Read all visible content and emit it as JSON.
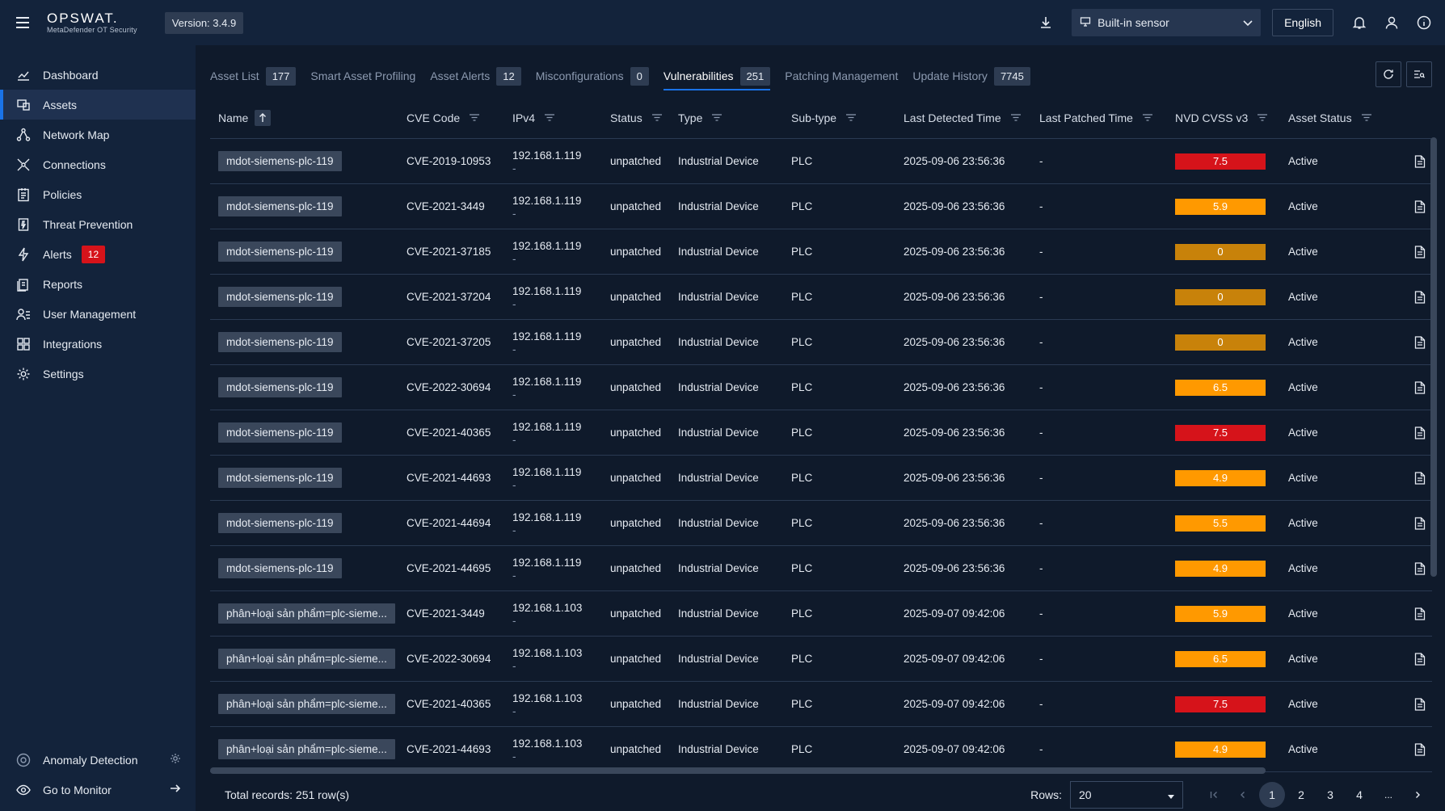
{
  "header": {
    "brand": "OPSWAT.",
    "product": "MetaDefender OT Security",
    "version": "Version: 3.4.9",
    "sensor": "Built-in sensor",
    "language": "English"
  },
  "sidebar": {
    "items": [
      {
        "label": "Dashboard",
        "icon": "chart-line-icon"
      },
      {
        "label": "Assets",
        "icon": "assets-icon"
      },
      {
        "label": "Network Map",
        "icon": "network-map-icon"
      },
      {
        "label": "Connections",
        "icon": "connections-icon"
      },
      {
        "label": "Policies",
        "icon": "policies-icon"
      },
      {
        "label": "Threat Prevention",
        "icon": "threat-prevention-icon"
      },
      {
        "label": "Alerts",
        "icon": "bolt-icon",
        "badge": "12"
      },
      {
        "label": "Reports",
        "icon": "reports-icon"
      },
      {
        "label": "User Management",
        "icon": "user-management-icon"
      },
      {
        "label": "Integrations",
        "icon": "integrations-icon"
      },
      {
        "label": "Settings",
        "icon": "gear-icon"
      }
    ],
    "active_index": 1,
    "bottom": {
      "anomaly": "Anomaly Detection",
      "monitor": "Go to Monitor"
    }
  },
  "tabs": [
    {
      "label": "Asset List",
      "count": "177"
    },
    {
      "label": "Smart Asset Profiling",
      "count": ""
    },
    {
      "label": "Asset Alerts",
      "count": "12"
    },
    {
      "label": "Misconfigurations",
      "count": "0"
    },
    {
      "label": "Vulnerabilities",
      "count": "251",
      "active": true
    },
    {
      "label": "Patching Management",
      "count": ""
    },
    {
      "label": "Update History",
      "count": "7745"
    }
  ],
  "table": {
    "columns": [
      "Name",
      "CVE Code",
      "IPv4",
      "Status",
      "Type",
      "Sub-type",
      "Last Detected Time",
      "Last Patched Time",
      "NVD CVSS v3",
      "Asset Status"
    ],
    "rows": [
      {
        "name": "mdot-siemens-plc-119",
        "cve": "CVE-2019-10953",
        "ip": "192.168.1.119",
        "status": "unpatched",
        "type": "Industrial Device",
        "sub": "PLC",
        "ldt": "2025-09-06 23:56:36",
        "lpt": "-",
        "cvss": "7.5",
        "astat": "Active"
      },
      {
        "name": "mdot-siemens-plc-119",
        "cve": "CVE-2021-3449",
        "ip": "192.168.1.119",
        "status": "unpatched",
        "type": "Industrial Device",
        "sub": "PLC",
        "ldt": "2025-09-06 23:56:36",
        "lpt": "-",
        "cvss": "5.9",
        "astat": "Active"
      },
      {
        "name": "mdot-siemens-plc-119",
        "cve": "CVE-2021-37185",
        "ip": "192.168.1.119",
        "status": "unpatched",
        "type": "Industrial Device",
        "sub": "PLC",
        "ldt": "2025-09-06 23:56:36",
        "lpt": "-",
        "cvss": "0",
        "astat": "Active"
      },
      {
        "name": "mdot-siemens-plc-119",
        "cve": "CVE-2021-37204",
        "ip": "192.168.1.119",
        "status": "unpatched",
        "type": "Industrial Device",
        "sub": "PLC",
        "ldt": "2025-09-06 23:56:36",
        "lpt": "-",
        "cvss": "0",
        "astat": "Active"
      },
      {
        "name": "mdot-siemens-plc-119",
        "cve": "CVE-2021-37205",
        "ip": "192.168.1.119",
        "status": "unpatched",
        "type": "Industrial Device",
        "sub": "PLC",
        "ldt": "2025-09-06 23:56:36",
        "lpt": "-",
        "cvss": "0",
        "astat": "Active"
      },
      {
        "name": "mdot-siemens-plc-119",
        "cve": "CVE-2022-30694",
        "ip": "192.168.1.119",
        "status": "unpatched",
        "type": "Industrial Device",
        "sub": "PLC",
        "ldt": "2025-09-06 23:56:36",
        "lpt": "-",
        "cvss": "6.5",
        "astat": "Active"
      },
      {
        "name": "mdot-siemens-plc-119",
        "cve": "CVE-2021-40365",
        "ip": "192.168.1.119",
        "status": "unpatched",
        "type": "Industrial Device",
        "sub": "PLC",
        "ldt": "2025-09-06 23:56:36",
        "lpt": "-",
        "cvss": "7.5",
        "astat": "Active"
      },
      {
        "name": "mdot-siemens-plc-119",
        "cve": "CVE-2021-44693",
        "ip": "192.168.1.119",
        "status": "unpatched",
        "type": "Industrial Device",
        "sub": "PLC",
        "ldt": "2025-09-06 23:56:36",
        "lpt": "-",
        "cvss": "4.9",
        "astat": "Active"
      },
      {
        "name": "mdot-siemens-plc-119",
        "cve": "CVE-2021-44694",
        "ip": "192.168.1.119",
        "status": "unpatched",
        "type": "Industrial Device",
        "sub": "PLC",
        "ldt": "2025-09-06 23:56:36",
        "lpt": "-",
        "cvss": "5.5",
        "astat": "Active"
      },
      {
        "name": "mdot-siemens-plc-119",
        "cve": "CVE-2021-44695",
        "ip": "192.168.1.119",
        "status": "unpatched",
        "type": "Industrial Device",
        "sub": "PLC",
        "ldt": "2025-09-06 23:56:36",
        "lpt": "-",
        "cvss": "4.9",
        "astat": "Active"
      },
      {
        "name": "phân+loại sản phẩm=plc-sieme...",
        "cve": "CVE-2021-3449",
        "ip": "192.168.1.103",
        "status": "unpatched",
        "type": "Industrial Device",
        "sub": "PLC",
        "ldt": "2025-09-07 09:42:06",
        "lpt": "-",
        "cvss": "5.9",
        "astat": "Active"
      },
      {
        "name": "phân+loại sản phẩm=plc-sieme...",
        "cve": "CVE-2022-30694",
        "ip": "192.168.1.103",
        "status": "unpatched",
        "type": "Industrial Device",
        "sub": "PLC",
        "ldt": "2025-09-07 09:42:06",
        "lpt": "-",
        "cvss": "6.5",
        "astat": "Active"
      },
      {
        "name": "phân+loại sản phẩm=plc-sieme...",
        "cve": "CVE-2021-40365",
        "ip": "192.168.1.103",
        "status": "unpatched",
        "type": "Industrial Device",
        "sub": "PLC",
        "ldt": "2025-09-07 09:42:06",
        "lpt": "-",
        "cvss": "7.5",
        "astat": "Active"
      },
      {
        "name": "phân+loại sản phẩm=plc-sieme...",
        "cve": "CVE-2021-44693",
        "ip": "192.168.1.103",
        "status": "unpatched",
        "type": "Industrial Device",
        "sub": "PLC",
        "ldt": "2025-09-07 09:42:06",
        "lpt": "-",
        "cvss": "4.9",
        "astat": "Active"
      }
    ],
    "ip_suffix": "-"
  },
  "colors": {
    "cvss_high": "#d6131a",
    "cvss_medium": "#ff9900",
    "cvss_zero": "#c8820a",
    "accent": "#1a73e8",
    "alert_badge": "#d6131a"
  },
  "footer": {
    "total": "Total records: 251 row(s)",
    "rows_label": "Rows:",
    "rows_value": "20",
    "pages": [
      "1",
      "2",
      "3",
      "4"
    ],
    "ellipsis": "...",
    "current_page": "1"
  }
}
